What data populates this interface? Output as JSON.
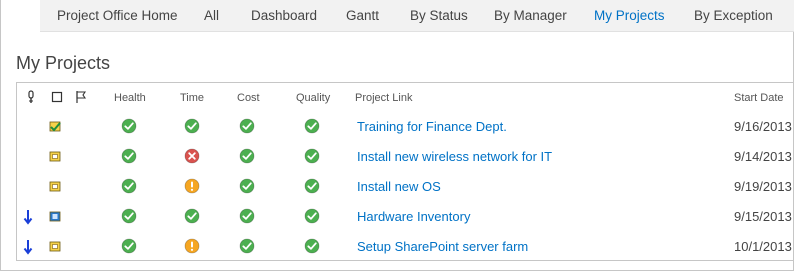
{
  "nav": {
    "tabs": [
      {
        "label": "Project Office Home",
        "active": false
      },
      {
        "label": "All",
        "active": false
      },
      {
        "label": "Dashboard",
        "active": false
      },
      {
        "label": "Gantt",
        "active": false
      },
      {
        "label": "By Status",
        "active": false
      },
      {
        "label": "By Manager",
        "active": false
      },
      {
        "label": "My Projects",
        "active": true
      },
      {
        "label": "By Exception",
        "active": false
      }
    ]
  },
  "page": {
    "title": "My Projects"
  },
  "table": {
    "header_icons": [
      "priority-icon",
      "item-type-icon",
      "flag-icon"
    ],
    "columns": {
      "health": "Health",
      "time": "Time",
      "cost": "Cost",
      "quality": "Quality",
      "project_link": "Project Link",
      "start_date": "Start Date"
    },
    "rows": [
      {
        "priority": "normal",
        "type_icon": "project-complete-icon",
        "health": "ok",
        "time": "ok",
        "cost": "ok",
        "quality": "ok",
        "project": "Training for Finance Dept.",
        "start_date": "9/16/2013"
      },
      {
        "priority": "normal",
        "type_icon": "project-active-icon",
        "health": "ok",
        "time": "error",
        "cost": "ok",
        "quality": "ok",
        "project": "Install new wireless network for IT",
        "start_date": "9/14/2013"
      },
      {
        "priority": "normal",
        "type_icon": "project-active-icon",
        "health": "ok",
        "time": "warning",
        "cost": "ok",
        "quality": "ok",
        "project": "Install new OS",
        "start_date": "9/19/2013"
      },
      {
        "priority": "low",
        "type_icon": "project-document-icon",
        "health": "ok",
        "time": "ok",
        "cost": "ok",
        "quality": "ok",
        "project": "Hardware Inventory",
        "start_date": "9/15/2013"
      },
      {
        "priority": "low",
        "type_icon": "project-active-icon",
        "health": "ok",
        "time": "warning",
        "cost": "ok",
        "quality": "ok",
        "project": "Setup SharePoint server farm",
        "start_date": "10/1/2013"
      }
    ]
  },
  "colors": {
    "accent": "#0072c6",
    "ok": "#4caf50",
    "warning": "#f5a623",
    "error": "#d9534f",
    "low_priority": "#1a3fd8"
  }
}
